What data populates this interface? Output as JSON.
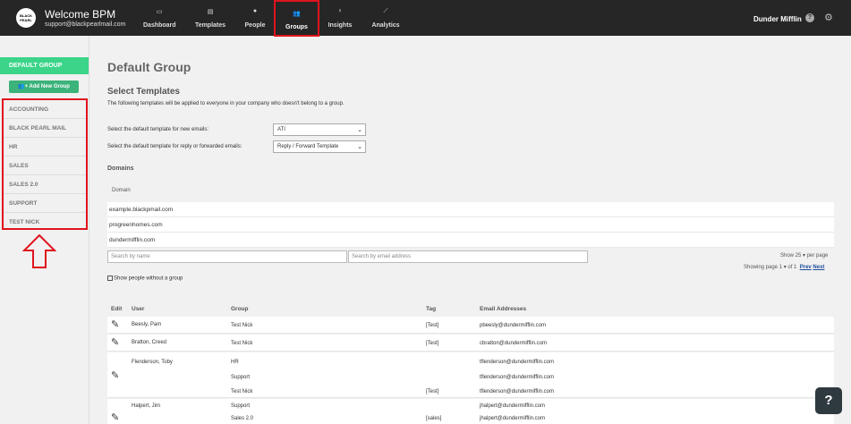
{
  "header": {
    "logo_text": "BLACK PEARL",
    "title": "Welcome BPM",
    "email": "support@blackpearlmail.com",
    "nav": [
      {
        "label": "Dashboard",
        "icon": "monitor-icon",
        "glyph": "▭"
      },
      {
        "label": "Templates",
        "icon": "template-icon",
        "glyph": "▤"
      },
      {
        "label": "People",
        "icon": "person-icon",
        "glyph": "●"
      },
      {
        "label": "Groups",
        "icon": "group-icon",
        "glyph": "👥"
      },
      {
        "label": "Insights",
        "icon": "lightbulb-icon",
        "glyph": "♀"
      },
      {
        "label": "Analytics",
        "icon": "chart-icon",
        "glyph": "⟋"
      }
    ],
    "company": "Dunder Mifflin",
    "help_glyph": "?",
    "settings_glyph": "⚙"
  },
  "sidebar": {
    "default_group": "DEFAULT GROUP",
    "add_button": "Add New Group",
    "add_icon_glyph": "👥+",
    "groups": [
      "ACCOUNTING",
      "BLACK PEARL MAIL",
      "HR",
      "SALES",
      "SALES 2.0",
      "SUPPORT",
      "TEST NICK"
    ]
  },
  "main": {
    "title": "Default Group",
    "section_title": "Select Templates",
    "section_desc": "The following templates will be applied to everyone in your company who doesn't belong to a group.",
    "new_email_label": "Select the default template for new emails:",
    "new_email_value": "ATI",
    "reply_label": "Select the default template for reply or forwarded emails:",
    "reply_value": "Reply / Forward Template",
    "domains_title": "Domains",
    "domain_header": "Domain",
    "domains": [
      "example.blackpmail.com",
      "progreenhomes.com",
      "dundermifflin.com"
    ],
    "search_name_placeholder": "Search by name",
    "search_email_placeholder": "Search by email address",
    "show_text": "Show 25 ▾ per page",
    "paging_text": "Showing page 1 ▾ of 1",
    "prev": "Prev",
    "next": "Next",
    "no_group_label": "Show people without a group",
    "columns": {
      "edit": "Edit",
      "user": "User",
      "group": "Group",
      "tag": "Tag",
      "email": "Email Addresses"
    },
    "edit_glyph": "✎",
    "rows": [
      {
        "user": "Beesly, Pam",
        "group": "Test Nick",
        "tag": "[Test]",
        "email": "pbeesly@dundermifflin.com"
      },
      {
        "user": "Bratton, Creed",
        "group": "Test Nick",
        "tag": "[Test]",
        "email": "cbratton@dundermifflin.com"
      },
      {
        "user": "Flenderson, Toby",
        "group": "HR",
        "tag": "",
        "email": "tflenderson@dundermifflin.com"
      },
      {
        "user": "",
        "group": "Support",
        "tag": "",
        "email": "tflenderson@dundermifflin.com"
      },
      {
        "user": "",
        "group": "Test Nick",
        "tag": "[Test]",
        "email": "tflenderson@dundermifflin.com"
      },
      {
        "user": "Halpert, Jim",
        "group": "Support",
        "tag": "",
        "email": "jhalpert@dundermifflin.com"
      },
      {
        "user": "",
        "group": "Sales 2.0",
        "tag": "[sales]",
        "email": "jhalpert@dundermifflin.com"
      }
    ]
  },
  "help_button": "?"
}
